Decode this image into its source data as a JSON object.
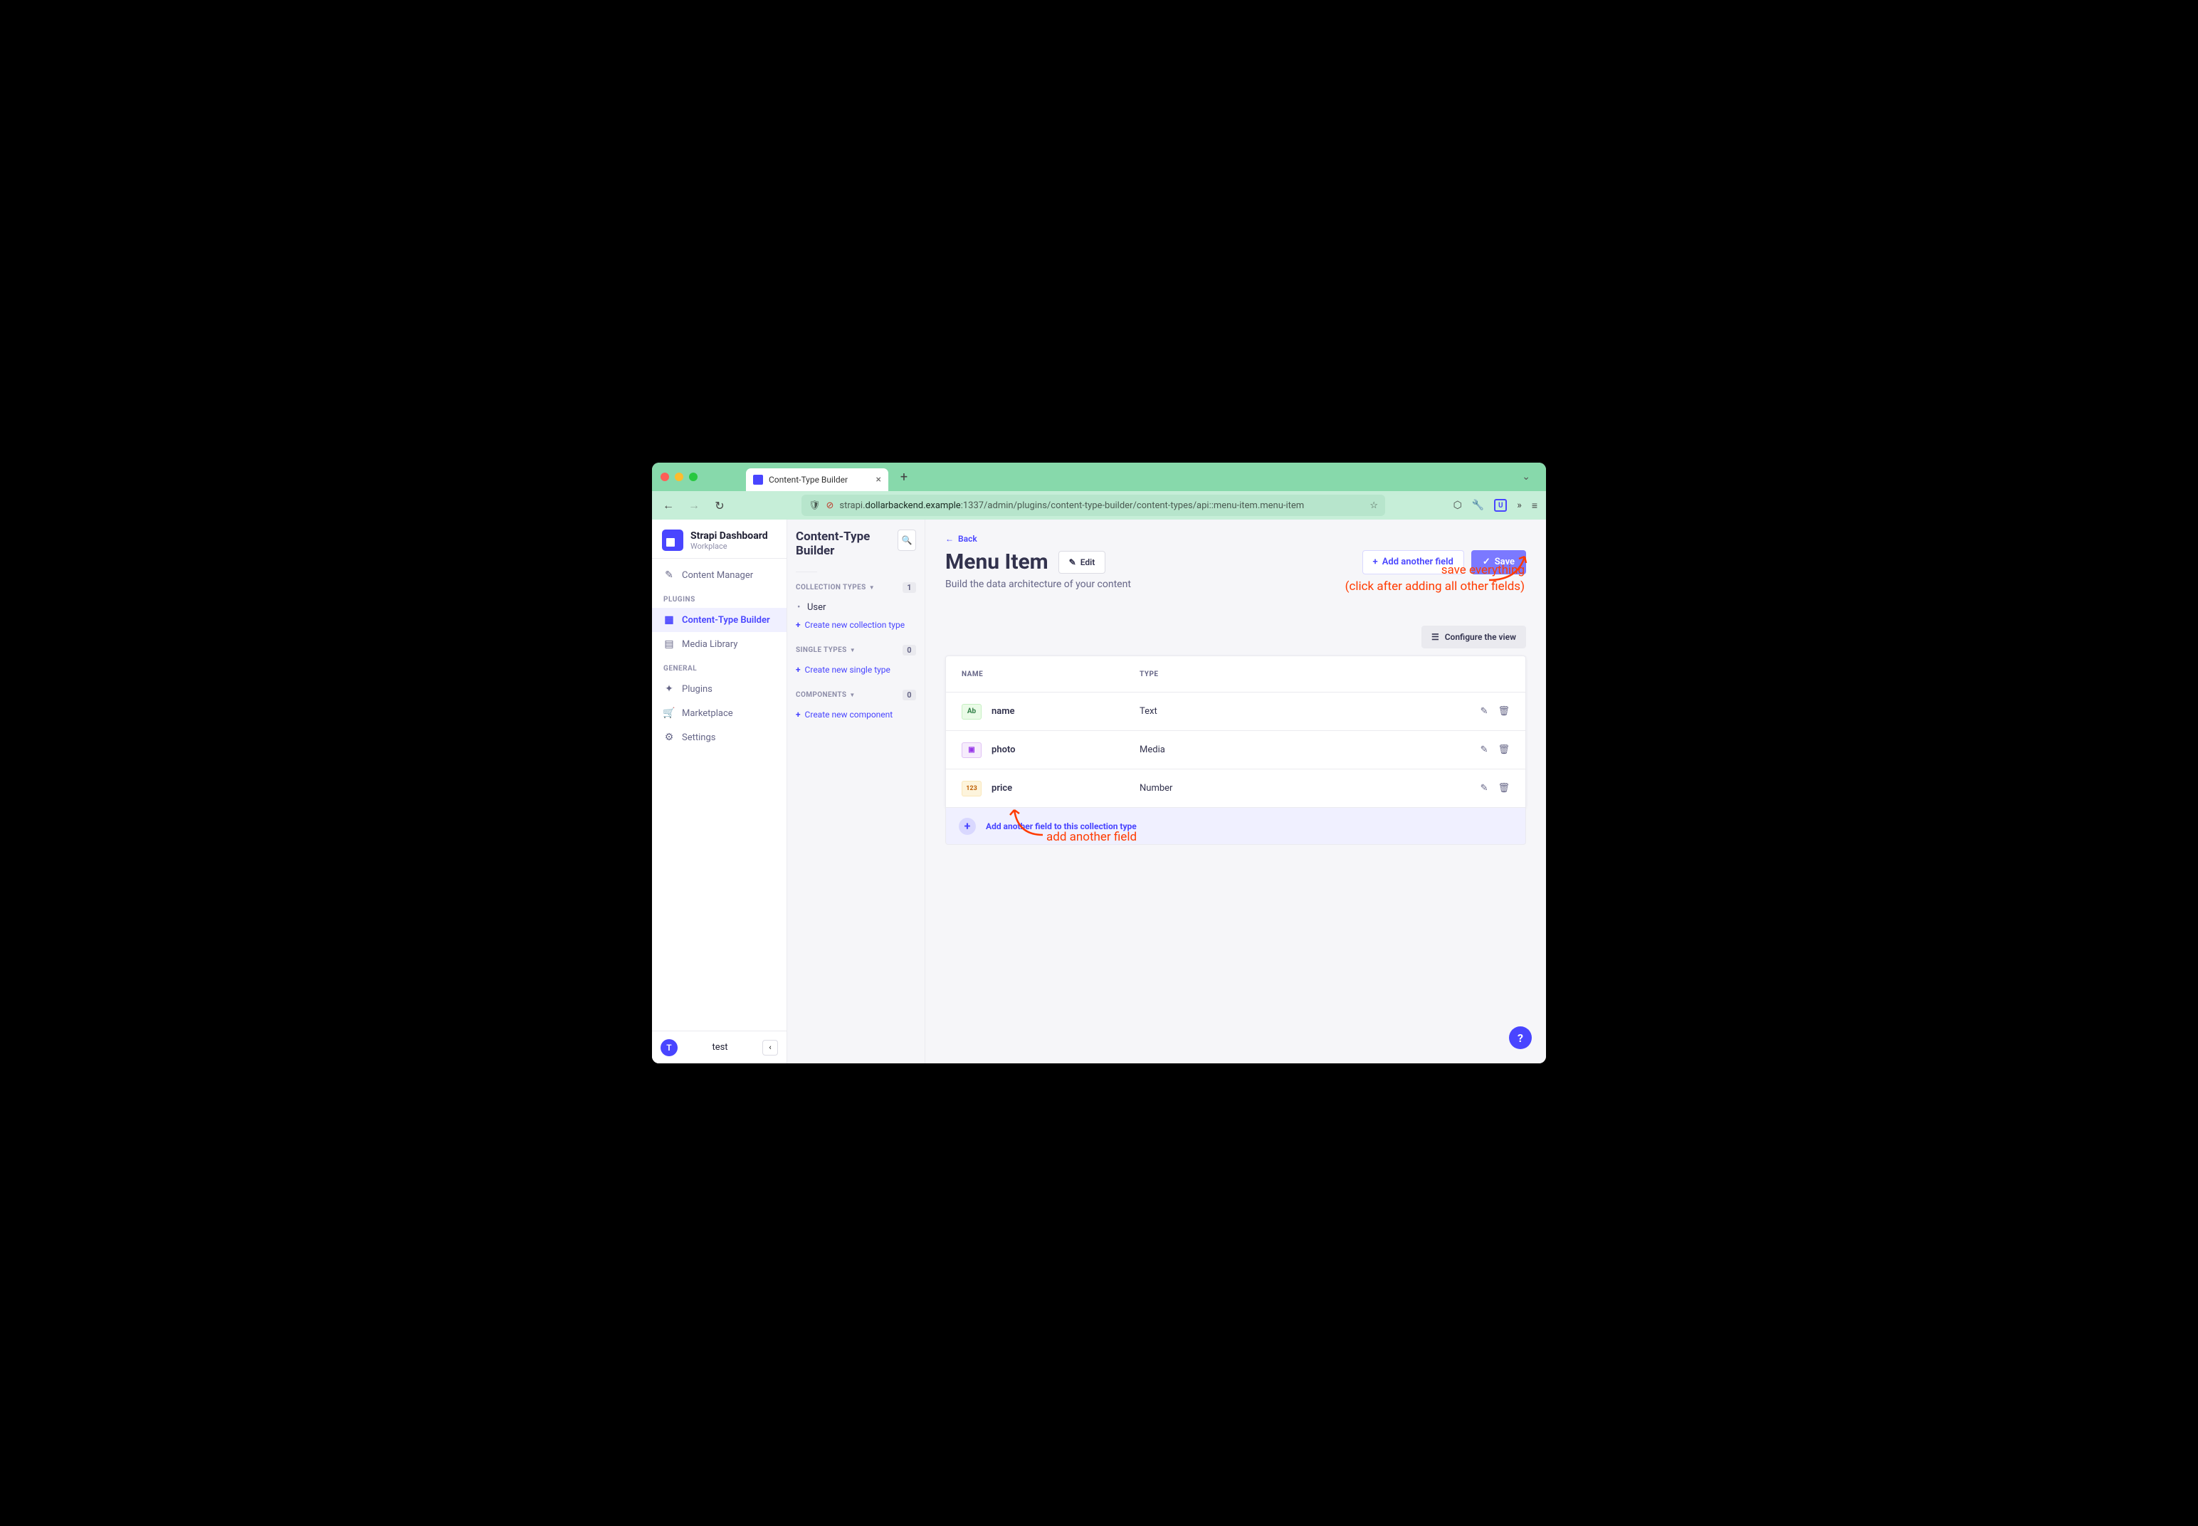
{
  "browser": {
    "tab_title": "Content-Type Builder",
    "url_pre": "strapi.",
    "url_host": "dollarbackend.example",
    "url_post": ":1337/admin/plugins/content-type-builder/content-types/api::menu-item.menu-item"
  },
  "sidebar": {
    "brand": "Strapi Dashboard",
    "brand_sub": "Workplace",
    "items": [
      {
        "label": "Content Manager",
        "icon": "✎"
      }
    ],
    "plugins_header": "PLUGINS",
    "plugins": [
      {
        "label": "Content-Type Builder",
        "icon": "▦",
        "active": true
      },
      {
        "label": "Media Library",
        "icon": "▤"
      }
    ],
    "general_header": "GENERAL",
    "general": [
      {
        "label": "Plugins",
        "icon": "✦"
      },
      {
        "label": "Marketplace",
        "icon": "🛒"
      },
      {
        "label": "Settings",
        "icon": "⚙"
      }
    ],
    "footer_initial": "T",
    "footer_name": "test"
  },
  "sidebar2": {
    "title": "Content-Type Builder",
    "groups": [
      {
        "header": "COLLECTION TYPES",
        "count": "1",
        "items": [
          "User"
        ],
        "add": "Create new collection type"
      },
      {
        "header": "SINGLE TYPES",
        "count": "0",
        "items": [],
        "add": "Create new single type"
      },
      {
        "header": "COMPONENTS",
        "count": "0",
        "items": [],
        "add": "Create new component"
      }
    ]
  },
  "main": {
    "back": "Back",
    "title": "Menu Item",
    "edit": "Edit",
    "add_field": "Add another field",
    "save": "Save",
    "subtitle": "Build the data architecture of your content",
    "configure": "Configure the view",
    "th_name": "NAME",
    "th_type": "TYPE",
    "fields": [
      {
        "name": "name",
        "type": "Text",
        "badge": "Ab",
        "cls": "text"
      },
      {
        "name": "photo",
        "type": "Media",
        "badge": "▣",
        "cls": "media"
      },
      {
        "name": "price",
        "type": "Number",
        "badge": "123",
        "cls": "number"
      }
    ],
    "add_row": "Add another field to this collection type"
  },
  "annotations": {
    "save1": "save everything",
    "save2": "(click after adding all other fields)",
    "addfld": "add another field"
  }
}
